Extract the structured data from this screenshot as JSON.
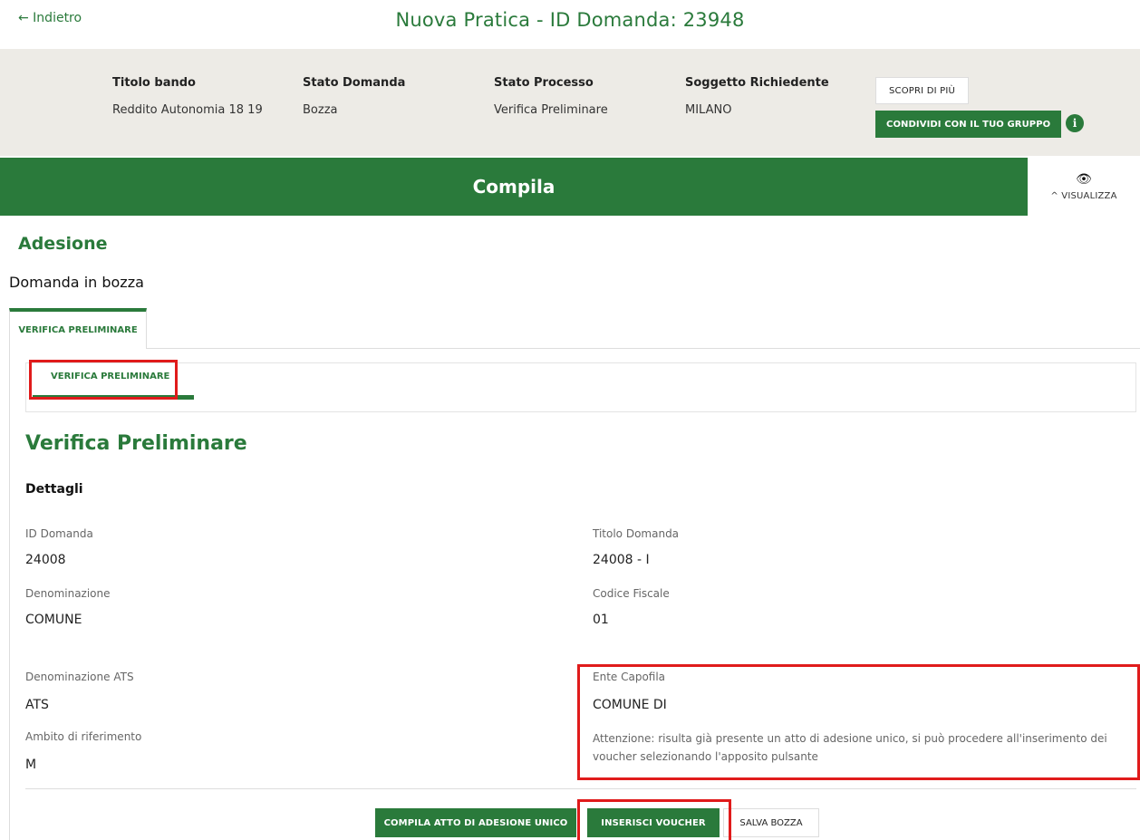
{
  "nav": {
    "back_label": "← Indietro"
  },
  "header": {
    "title": "Nuova Pratica - ID Domanda: 23948"
  },
  "info": {
    "fields": [
      {
        "label": "Titolo bando",
        "value": "Reddito Autonomia 18 19"
      },
      {
        "label": "Stato Domanda",
        "value": "Bozza"
      },
      {
        "label": "Stato Processo",
        "value": "Verifica Preliminare"
      },
      {
        "label": "Soggetto Richiedente",
        "value": "MILANO"
      }
    ],
    "scopri_label": "SCOPRI DI PIÙ",
    "condividi_label": "CONDIVIDI CON IL TUO GRUPPO",
    "info_glyph": "i"
  },
  "compila": {
    "title": "Compila",
    "visualizza_label": "^  VISUALIZZA",
    "eye_glyph": "👁"
  },
  "section": {
    "title": "Adesione",
    "subtitle": "Domanda in bozza"
  },
  "tabs": {
    "outer_label": "VERIFICA PRELIMINARE",
    "inner_label": "VERIFICA PRELIMINARE"
  },
  "form": {
    "title": "Verifica Preliminare",
    "subtitle": "Dettagli",
    "id_domanda": {
      "label": "ID Domanda",
      "value": "24008"
    },
    "titolo_domanda": {
      "label": "Titolo Domanda",
      "value": "24008 - I"
    },
    "denominazione": {
      "label": "Denominazione",
      "value": "COMUNE"
    },
    "codice_fiscale": {
      "label": "Codice Fiscale",
      "value": "01"
    },
    "denominazione_ats": {
      "label": "Denominazione ATS",
      "value": "ATS"
    },
    "ente_capofila": {
      "label": "Ente Capofila",
      "value": "COMUNE DI"
    },
    "ambito": {
      "label": "Ambito di riferimento",
      "value": "M"
    },
    "attention": "Attenzione: risulta già presente un atto di adesione unico, si può procedere all'inserimento dei voucher selezionando l'apposito pulsante"
  },
  "actions": {
    "compila_atto": "COMPILA ATTO DI ADESIONE UNICO",
    "inserisci_voucher": "INSERISCI VOUCHER",
    "salva_bozza": "SALVA BOZZA"
  },
  "colors": {
    "brand_green": "#2a7a3b",
    "highlight_red": "#e01b1b",
    "band_bg": "#edebe6"
  }
}
